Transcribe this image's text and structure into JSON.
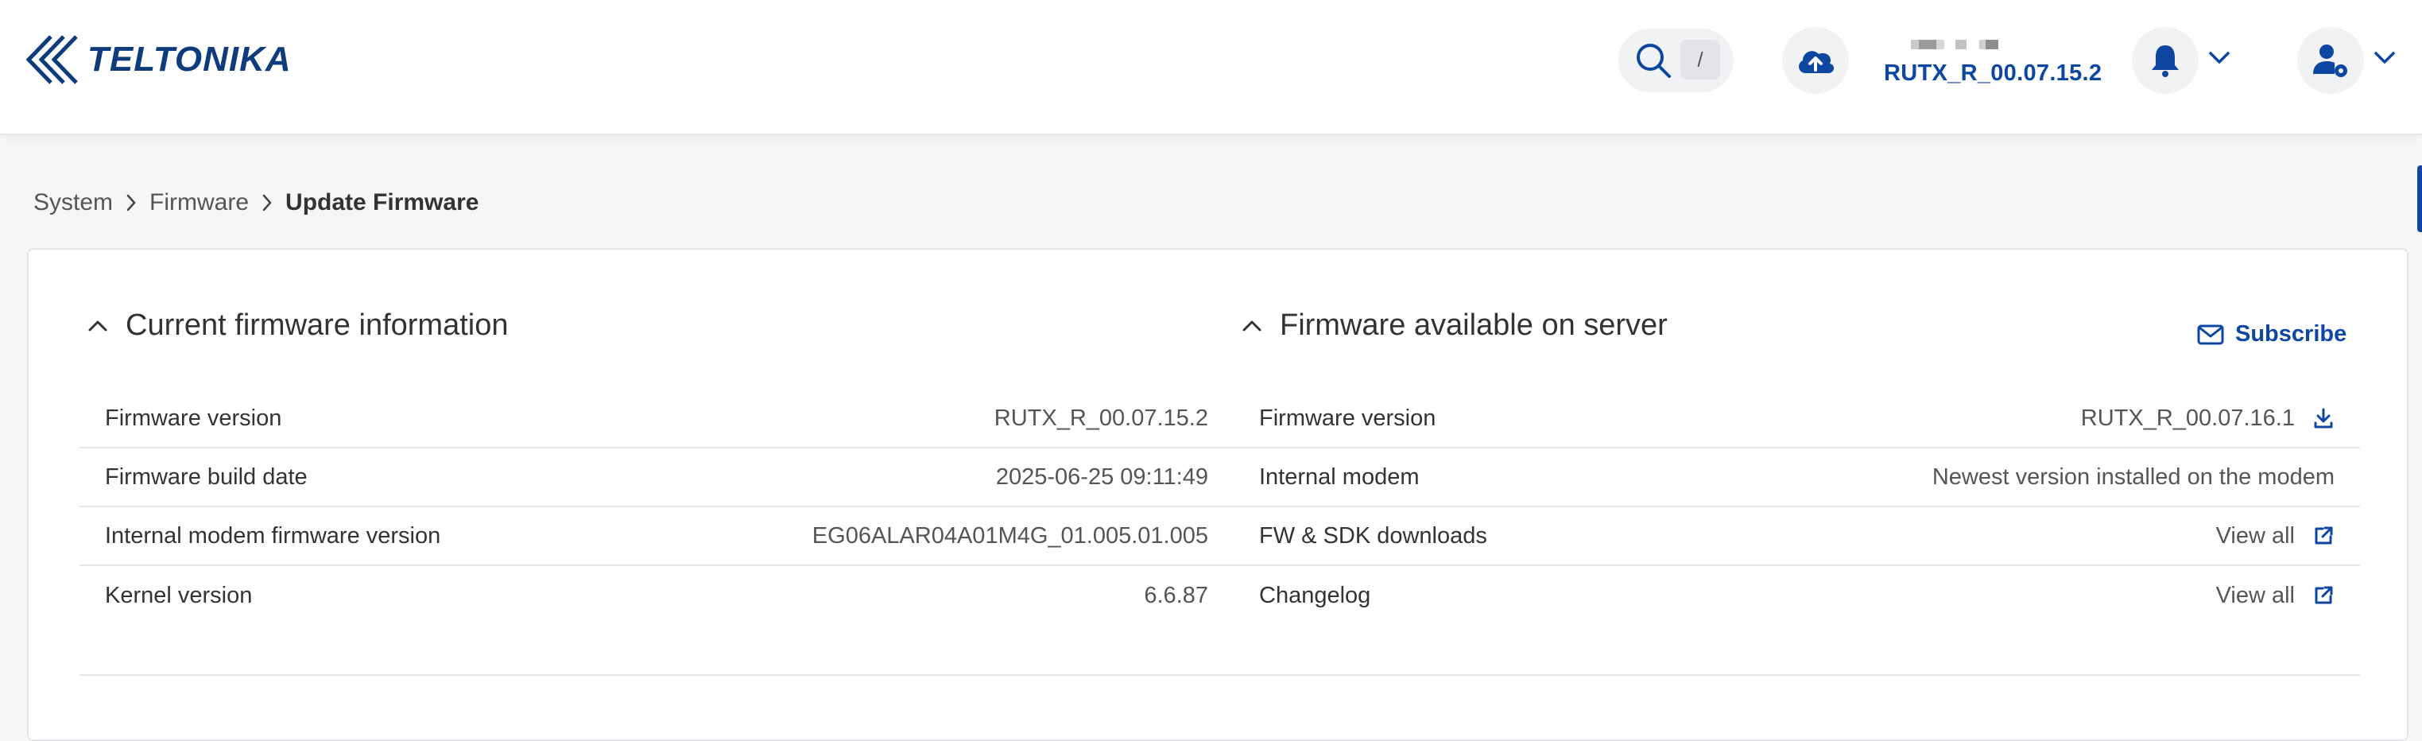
{
  "header": {
    "brand": "TELTONIKA",
    "search_shortcut": "/",
    "device_firmware": "RUTX_R_00.07.15.2",
    "icons": {
      "search": "search-icon",
      "cloud": "cloud-upload-icon",
      "notifications": "bell-icon",
      "user": "user-settings-icon"
    }
  },
  "breadcrumb": {
    "items": [
      "System",
      "Firmware"
    ],
    "current": "Update Firmware"
  },
  "current_firmware": {
    "title": "Current firmware information",
    "rows": [
      {
        "label": "Firmware version",
        "value": "RUTX_R_00.07.15.2"
      },
      {
        "label": "Firmware build date",
        "value": "2025-06-25 09:11:49"
      },
      {
        "label": "Internal modem firmware version",
        "value": "EG06ALAR04A01M4G_01.005.01.005"
      },
      {
        "label": "Kernel version",
        "value": "6.6.87"
      }
    ]
  },
  "server_firmware": {
    "title": "Firmware available on server",
    "subscribe_label": "Subscribe",
    "rows": [
      {
        "label": "Firmware version",
        "value": "RUTX_R_00.07.16.1",
        "icon": "download-icon"
      },
      {
        "label": "Internal modem",
        "value": "Newest version installed on the modem"
      },
      {
        "label": "FW & SDK downloads",
        "value": "View all",
        "icon": "external-link-icon"
      },
      {
        "label": "Changelog",
        "value": "View all",
        "icon": "external-link-icon"
      }
    ]
  },
  "colors": {
    "accent": "#0d47a1",
    "brand": "#0d3b7c",
    "border": "#e4e5e8"
  }
}
